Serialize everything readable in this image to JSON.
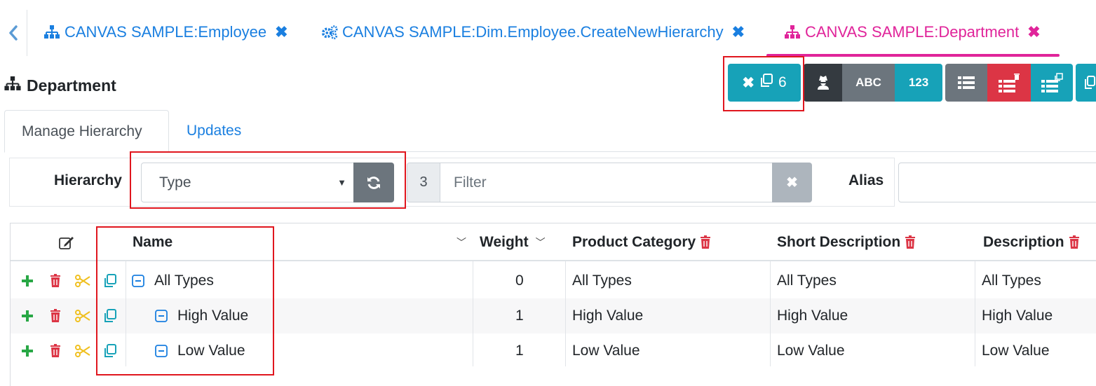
{
  "tabs": [
    {
      "label": "CANVAS SAMPLE:Employee",
      "icon": "hierarchy-icon",
      "active": false
    },
    {
      "label": "CANVAS SAMPLE:Dim.Employee.CreateNewHierarchy",
      "icon": "cogs-icon",
      "active": false
    },
    {
      "label": "CANVAS SAMPLE:Department",
      "icon": "hierarchy-icon",
      "active": true
    }
  ],
  "header": {
    "title": "Department"
  },
  "toolbar": {
    "copy_all_count": "6",
    "abc_label": "ABC",
    "num_label": "123"
  },
  "subtabs": [
    {
      "label": "Manage Hierarchy",
      "active": true
    },
    {
      "label": "Updates",
      "active": false
    }
  ],
  "filters": {
    "hierarchy_label": "Hierarchy",
    "hierarchy_value": "Type",
    "count": "3",
    "filter_placeholder": "Filter",
    "alias_label": "Alias",
    "alias_value": ""
  },
  "grid": {
    "columns": {
      "name": "Name",
      "weight": "Weight",
      "product_category": "Product Category",
      "short_description": "Short Description",
      "description": "Description"
    },
    "rows": [
      {
        "name": "All Types",
        "weight": "0",
        "product_category": "All Types",
        "short_description": "All Types",
        "description": "All Types",
        "level": 0
      },
      {
        "name": "High Value",
        "weight": "1",
        "product_category": "High Value",
        "short_description": "High Value",
        "description": "High Value",
        "level": 1
      },
      {
        "name": "Low Value",
        "weight": "1",
        "product_category": "Low Value",
        "short_description": "Low Value",
        "description": "Low Value",
        "level": 1
      }
    ]
  },
  "colors": {
    "link_blue": "#1a7fe0",
    "active_tab_pink": "#e0249a",
    "info_teal": "#17a2b8",
    "danger_red": "#dc3545",
    "add_green": "#28a745",
    "cut_yellow": "#f0c020",
    "highlight_box": "#e0161e"
  }
}
